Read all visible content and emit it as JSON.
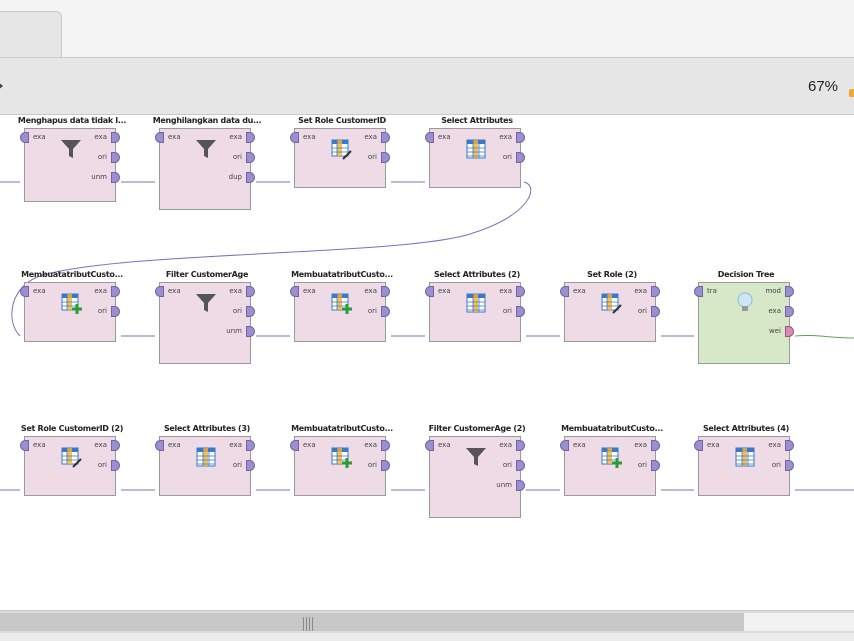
{
  "window": {
    "zoom": "67%",
    "colors": {
      "toolbar": "#e6e6e6",
      "operator": "#efdbe6",
      "learner": "#d6e8c8",
      "wire": "#7b6fc0",
      "model_wire": "#5aa75a",
      "port": "#9c8fd0"
    }
  },
  "operators": [
    {
      "id": "op1",
      "title": "Menghapus data tidak l...",
      "icon": "filter-icon",
      "in": [
        "exa"
      ],
      "out": [
        "exa",
        "ori",
        "unm"
      ]
    },
    {
      "id": "op2",
      "title": "Menghilangkan data du...",
      "icon": "filter-icon",
      "in": [
        "exa"
      ],
      "out": [
        "exa",
        "ori",
        "dup"
      ]
    },
    {
      "id": "op3",
      "title": "Set Role CustomerID",
      "icon": "set-role-icon",
      "in": [
        "exa"
      ],
      "out": [
        "exa",
        "ori"
      ]
    },
    {
      "id": "op4",
      "title": "Select Attributes",
      "icon": "table-icon",
      "in": [
        "exa"
      ],
      "out": [
        "exa",
        "ori"
      ]
    },
    {
      "id": "op5",
      "title": "MembuatatributCusto...",
      "icon": "generate-attribute-icon",
      "in": [
        "exa"
      ],
      "out": [
        "exa",
        "ori"
      ]
    },
    {
      "id": "op6",
      "title": "Filter CustomerAge",
      "icon": "filter-icon",
      "in": [
        "exa"
      ],
      "out": [
        "exa",
        "ori",
        "unm"
      ]
    },
    {
      "id": "op7",
      "title": "MembuatatributCusto...",
      "icon": "generate-attribute-icon",
      "in": [
        "exa"
      ],
      "out": [
        "exa",
        "ori"
      ]
    },
    {
      "id": "op8",
      "title": "Select Attributes (2)",
      "icon": "table-icon",
      "in": [
        "exa"
      ],
      "out": [
        "exa",
        "ori"
      ]
    },
    {
      "id": "op9",
      "title": "Set Role (2)",
      "icon": "set-role-icon",
      "in": [
        "exa"
      ],
      "out": [
        "exa",
        "ori"
      ]
    },
    {
      "id": "op10",
      "title": "Decision Tree",
      "icon": "lightbulb-icon",
      "in": [
        "tra"
      ],
      "out": [
        "mod",
        "exa",
        "wei"
      ]
    },
    {
      "id": "op11",
      "title": "Set Role CustomerID (2)",
      "icon": "set-role-icon",
      "in": [
        "exa"
      ],
      "out": [
        "exa",
        "ori"
      ]
    },
    {
      "id": "op12",
      "title": "Select Attributes (3)",
      "icon": "table-icon",
      "in": [
        "exa"
      ],
      "out": [
        "exa",
        "ori"
      ]
    },
    {
      "id": "op13",
      "title": "MembuatatributCusto...",
      "icon": "generate-attribute-icon",
      "in": [
        "exa"
      ],
      "out": [
        "exa",
        "ori"
      ]
    },
    {
      "id": "op14",
      "title": "Filter CustomerAge (2)",
      "icon": "filter-icon",
      "in": [
        "exa"
      ],
      "out": [
        "exa",
        "ori",
        "unm"
      ]
    },
    {
      "id": "op15",
      "title": "MembuatatributCusto...",
      "icon": "generate-attribute-icon",
      "in": [
        "exa"
      ],
      "out": [
        "exa",
        "ori"
      ]
    },
    {
      "id": "op16",
      "title": "Select Attributes (4)",
      "icon": "table-icon",
      "in": [
        "exa"
      ],
      "out": [
        "exa",
        "ori"
      ]
    }
  ]
}
